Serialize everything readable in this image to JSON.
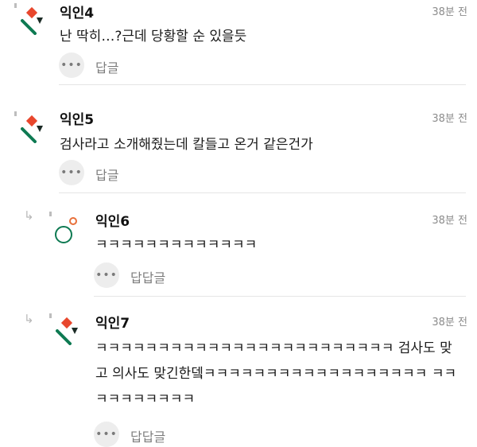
{
  "comments": [
    {
      "author": "익인4",
      "time": "38분 전",
      "text": "난 딱히…?근데 당황할 순 있을듯",
      "reply": "답글",
      "more": "•••"
    },
    {
      "author": "익인5",
      "time": "38분 전",
      "text": "검사라고 소개해줬는데 칼들고 온거 같은건가",
      "reply": "답글",
      "more": "•••"
    },
    {
      "author": "익인6",
      "time": "38분 전",
      "text": "ㅋㅋㅋㅋㅋㅋㅋㅋㅋㅋㅋㅋㅋ",
      "reply": "답답글",
      "more": "•••",
      "reply_arrow": "↳"
    },
    {
      "author": "익인7",
      "time": "38분 전",
      "text": "ㅋㅋㅋㅋㅋㅋㅋㅋㅋㅋㅋㅋㅋㅋㅋㅋㅋㅋㅋㅋㅋㅋㅋㅋ 검사도 맞고 의사도 맞긴한뎈ㅋㅋㅋㅋㅋㅋㅋㅋㅋㅋㅋㅋㅋㅋㅋㅋㅋㅋ ㅋㅋㅋㅋㅋㅋㅋㅋㅋㅋ",
      "reply": "답답글",
      "more": "•••",
      "reply_arrow": "↳"
    }
  ],
  "colors": {
    "red": "#e8472d",
    "green": "#0e7a52",
    "dark": "#1c2b26",
    "orange": "#e8703a"
  }
}
